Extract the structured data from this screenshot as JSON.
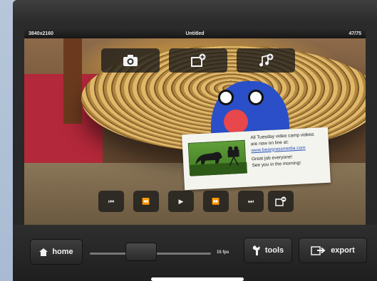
{
  "topbar": {
    "resolution": "3840x2160",
    "title": "Untitled",
    "frame_count": "47/75"
  },
  "top_actions": [
    {
      "name": "camera-icon"
    },
    {
      "name": "add-frame-icon"
    },
    {
      "name": "add-music-icon"
    }
  ],
  "card": {
    "line1": "All Tuesday video camp videos",
    "line2": "are now on line at:",
    "link": "www.beargrassmedia.com",
    "line3": "Great job everyone!",
    "line4": "See you in the morning!"
  },
  "transport": {
    "first_icon": "⏮",
    "rewind_icon": "⏪",
    "play_icon": "▶",
    "forward_icon": "⏩",
    "last_icon": "⏭",
    "delete_icon": "delete-frame-icon"
  },
  "bottom": {
    "home_label": "home",
    "fps_label": "15 fps",
    "fps_value": 0.4,
    "tools_label": "tools",
    "export_label": "export"
  },
  "colors": {
    "bar": "#262626",
    "button": "#333333",
    "text": "#f2f2f2"
  }
}
